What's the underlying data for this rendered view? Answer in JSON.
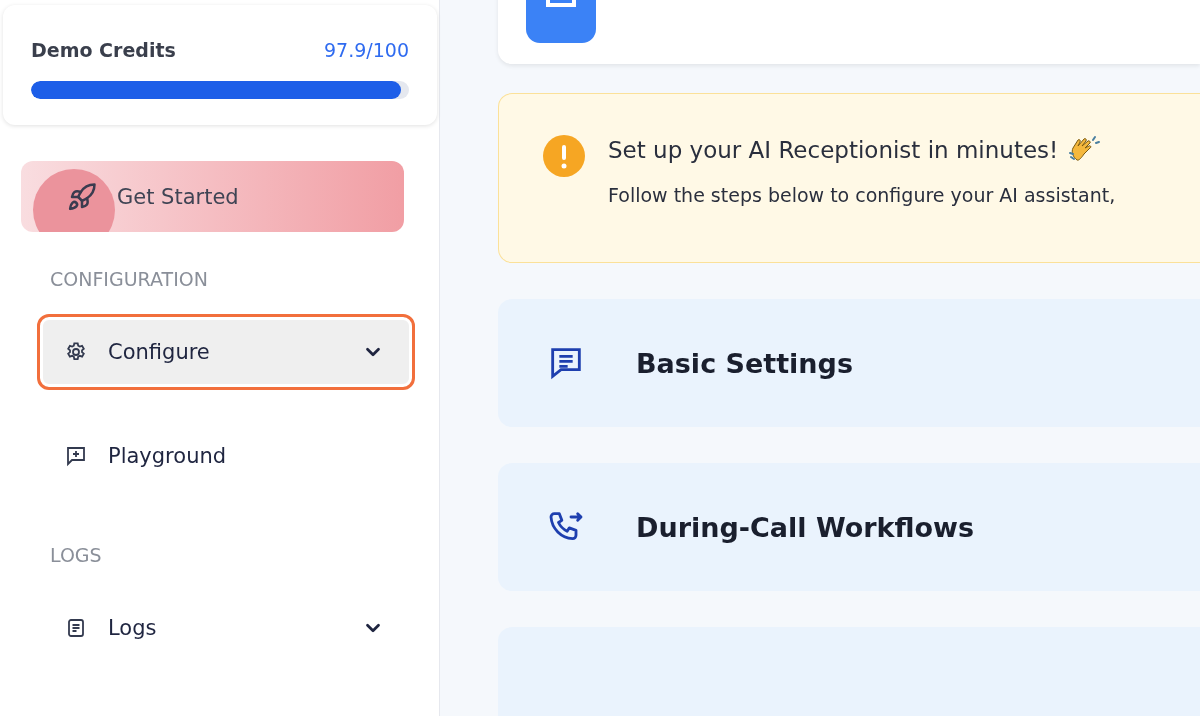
{
  "credits": {
    "label": "Demo Credits",
    "value": "97.9/100",
    "level": 0.979
  },
  "get_started": {
    "label": "Get Started"
  },
  "nav_sections": [
    {
      "heading": "CONFIGURATION",
      "items": [
        {
          "label": "Configure",
          "selected": true,
          "expandable": true
        },
        {
          "label": "Playground",
          "selected": false,
          "expandable": false
        }
      ]
    },
    {
      "heading": "LOGS",
      "items": [
        {
          "label": "Logs",
          "selected": false,
          "expandable": true
        }
      ]
    }
  ],
  "alert": {
    "title": "Set up your AI Receptionist in minutes!",
    "text": "Follow the steps below to configure your AI assistant,"
  },
  "sections": [
    {
      "kind": "titled",
      "title": "Basic Settings"
    },
    {
      "kind": "titled",
      "title": "During-Call Workflows"
    },
    {
      "kind": "empty"
    }
  ]
}
